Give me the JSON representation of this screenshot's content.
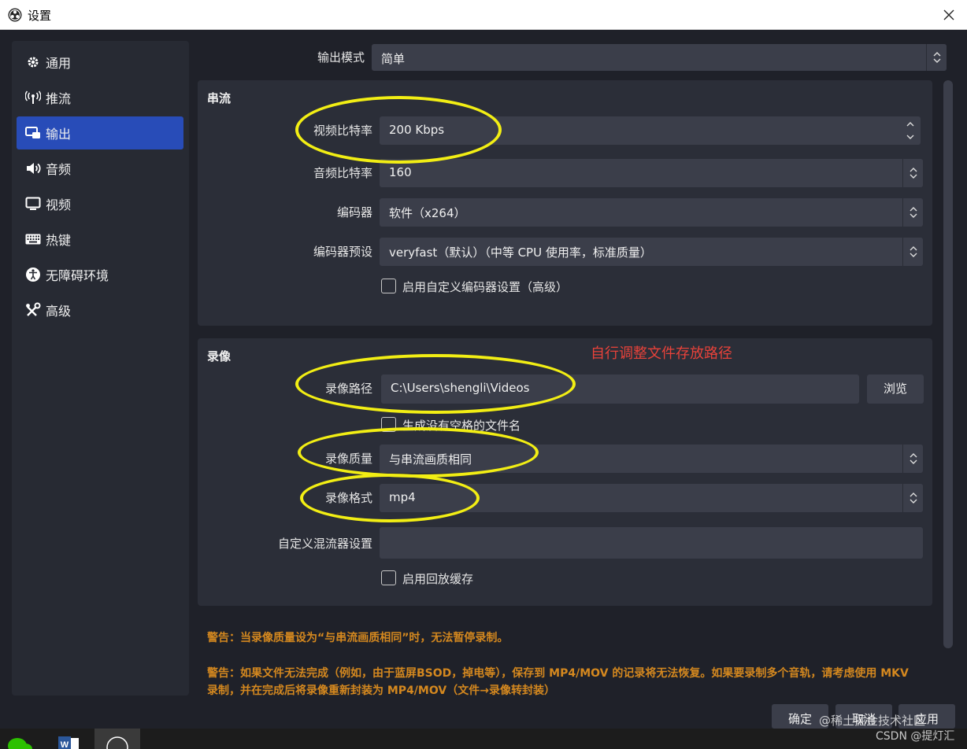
{
  "window": {
    "title": "设置"
  },
  "sidebar": {
    "items": [
      {
        "label": "通用",
        "icon": "gear-icon"
      },
      {
        "label": "推流",
        "icon": "antenna-icon"
      },
      {
        "label": "输出",
        "icon": "output-icon",
        "active": true
      },
      {
        "label": "音频",
        "icon": "speaker-icon"
      },
      {
        "label": "视频",
        "icon": "monitor-icon"
      },
      {
        "label": "热键",
        "icon": "keyboard-icon"
      },
      {
        "label": "无障碍环境",
        "icon": "accessibility-icon"
      },
      {
        "label": "高级",
        "icon": "tools-icon"
      }
    ]
  },
  "output_mode": {
    "label": "输出模式",
    "value": "简单"
  },
  "streaming": {
    "title": "串流",
    "video_bitrate": {
      "label": "视频比特率",
      "value": "200 Kbps"
    },
    "audio_bitrate": {
      "label": "音频比特率",
      "value": "160"
    },
    "encoder": {
      "label": "编码器",
      "value": "软件（x264）"
    },
    "encoder_preset": {
      "label": "编码器预设",
      "value": "veryfast（默认）（中等 CPU 使用率，标准质量）"
    },
    "custom_encoder_checkbox": "启用自定义编码器设置（高级）"
  },
  "recording": {
    "title": "录像",
    "annotation": "自行调整文件存放路径",
    "path": {
      "label": "录像路径",
      "value": "C:\\Users\\shengli\\Videos"
    },
    "browse_button": "浏览",
    "no_space_checkbox": "生成没有空格的文件名",
    "quality": {
      "label": "录像质量",
      "value": "与串流画质相同"
    },
    "format": {
      "label": "录像格式",
      "value": "mp4"
    },
    "muxer": {
      "label": "自定义混流器设置",
      "value": ""
    },
    "replay_buffer_checkbox": "启用回放缓存"
  },
  "warnings": {
    "pause": "警告：当录像质量设为“与串流画质相同”时，无法暂停录制。",
    "recovery": "警告：如果文件无法完成（例如，由于蓝屏BSOD，掉电等），保存到 MP4/MOV 的记录将无法恢复。如果要录制多个音轨，请考虑使用 MKV 录制，并在完成后将录像重新封装为 MP4/MOV（文件→录像转封装）"
  },
  "buttons": {
    "ok": "确定",
    "cancel": "取消",
    "apply": "应用"
  },
  "watermarks": {
    "juejin": "@稀土掘金技术社区",
    "csdn": "CSDN @提灯汇"
  },
  "colors": {
    "accent": "#284cb8",
    "warning": "#d4881f",
    "annotation": "#e8423a",
    "highlight": "#f2ee14"
  }
}
